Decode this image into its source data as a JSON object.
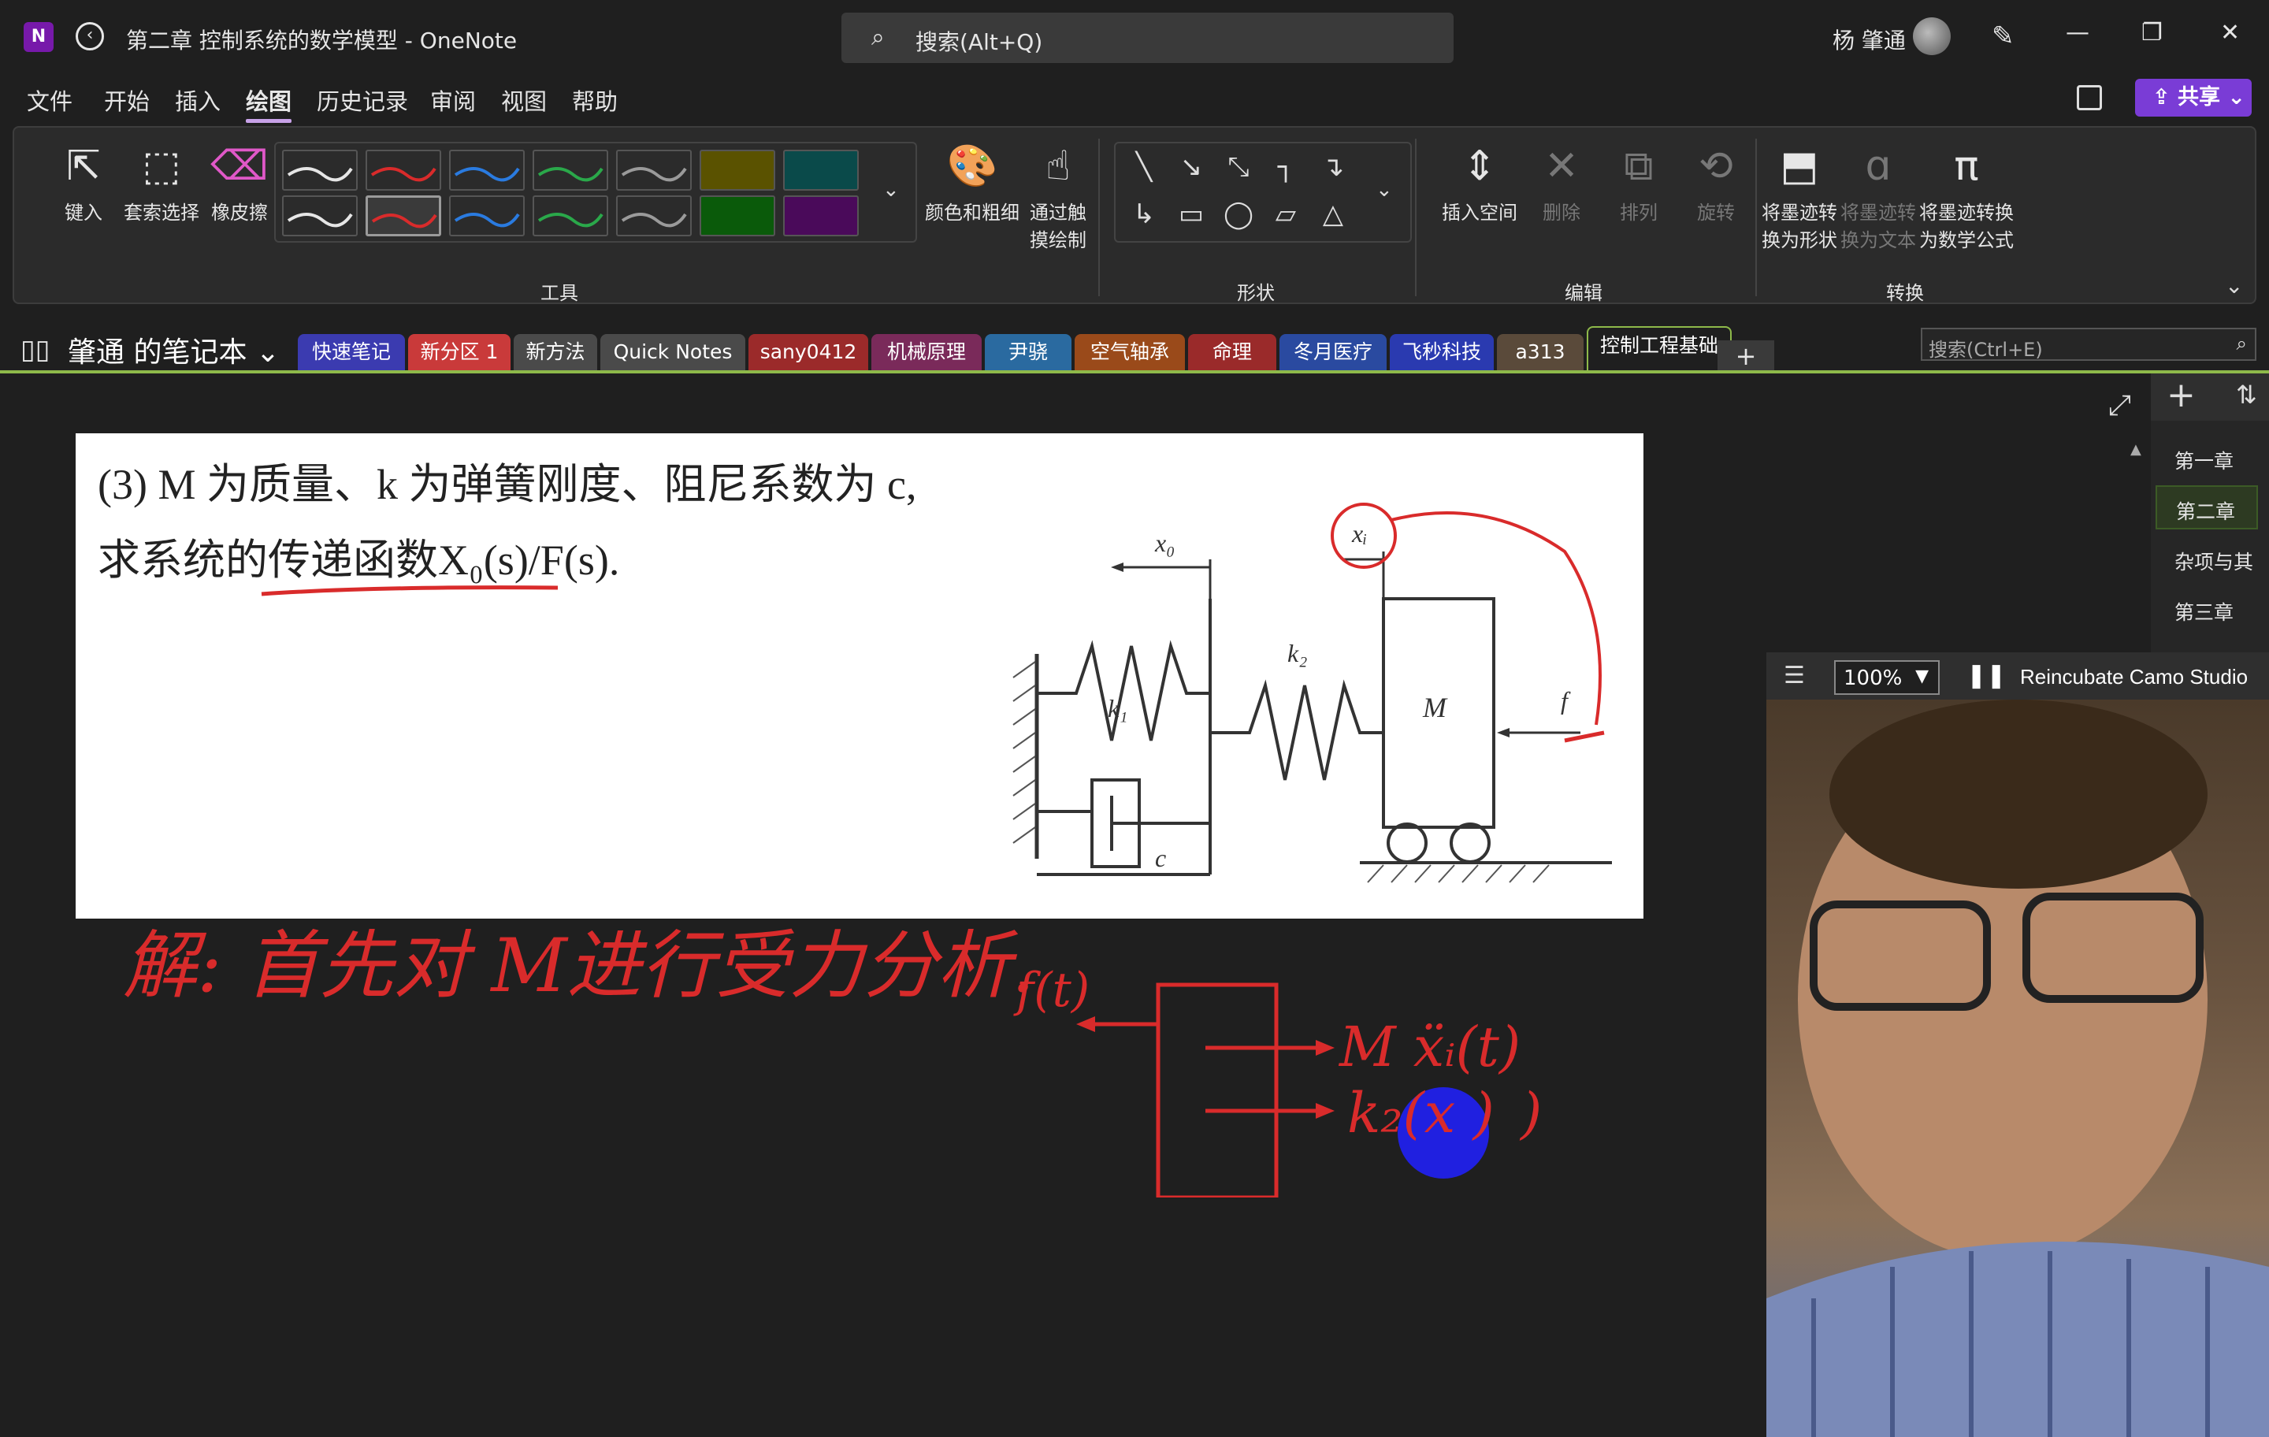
{
  "titlebar": {
    "app_icon": "N",
    "title": "第二章 控制系统的数学模型 - OneNote",
    "search_placeholder": "搜索(Alt+Q)",
    "user": "杨 肇通",
    "window_controls": [
      "—",
      "❐",
      "✕"
    ]
  },
  "menu": {
    "items": [
      "文件",
      "开始",
      "插入",
      "绘图",
      "历史记录",
      "审阅",
      "视图",
      "帮助"
    ],
    "active": "绘图",
    "share_label": "共享"
  },
  "ribbon": {
    "tools": {
      "type": "键入",
      "lasso": "套索选择",
      "eraser": "橡皮擦",
      "group": "工具"
    },
    "pen_colors_row1": [
      "#e6e6e6",
      "#d92b2b",
      "#2a7be0",
      "#2aa84a",
      "#9a9a9a",
      "#c8b400",
      "#1aa0a0"
    ],
    "pen_colors_row2": [
      "#e6e6e6",
      "#d92b2b",
      "#2a7be0",
      "#2aa84a",
      "#9a9a9a",
      "#2aa84a",
      "#b02ad0"
    ],
    "color_thickness": "颜色和粗细",
    "touch_draw": "通过触摸绘制",
    "shapes_group": "形状",
    "edit": {
      "insert_space": "插入空间",
      "delete": "删除",
      "arrange": "排列",
      "rotate": "旋转",
      "group": "编辑"
    },
    "convert": {
      "to_shape": "将墨迹转换为形状",
      "to_text": "将墨迹转换为文本",
      "to_math": "将墨迹转换为数学公式",
      "group": "转换"
    }
  },
  "notebook": {
    "name": "肇通 的笔记本",
    "sections": [
      {
        "label": "快速笔记",
        "color": "#3b3bb0"
      },
      {
        "label": "新分区 1",
        "color": "#c93a3a"
      },
      {
        "label": "新方法",
        "color": "#4a4a4a"
      },
      {
        "label": "Quick Notes",
        "color": "#4a4a4a"
      },
      {
        "label": "sany0412",
        "color": "#9b2a2a"
      },
      {
        "label": "机械原理",
        "color": "#7a2a5a"
      },
      {
        "label": "尹骁",
        "color": "#2a6aa0"
      },
      {
        "label": "空气轴承",
        "color": "#9a4a1a"
      },
      {
        "label": "命理",
        "color": "#9a2a2a"
      },
      {
        "label": "冬月医疗",
        "color": "#2a4aa0"
      },
      {
        "label": "飞秒科技",
        "color": "#2a3ab0"
      },
      {
        "label": "a313",
        "color": "#5a4a3a"
      },
      {
        "label": "控制工程基础",
        "color": "#1f1f1f"
      }
    ],
    "active_section": "控制工程基础",
    "add_section": "+",
    "search_placeholder": "搜索(Ctrl+E)"
  },
  "problem": {
    "line1": "(3) M 为质量、k 为弹簧刚度、阻尼系数为 c,",
    "line2": "求系统的传递函数X₀(s)/F(s).",
    "figure_labels": {
      "x0": "x₀",
      "xi": "xᵢ",
      "k1": "k₁",
      "k2": "k₂",
      "M": "M",
      "c": "c",
      "f": "f"
    }
  },
  "handwriting": {
    "solution": "解: 首先对 M进行受力分析.",
    "force_ft": "f(t)",
    "force_inertia": "M ẍᵢ(t)",
    "force_spring": "k₂(x )",
    "ink_color": "#d92b2b"
  },
  "pages": {
    "items": [
      "第一章",
      "第二章",
      "杂项与其",
      "第三章"
    ],
    "active": "第二章"
  },
  "camo": {
    "zoom": "100%",
    "title": "Reincubate Camo Studio"
  }
}
